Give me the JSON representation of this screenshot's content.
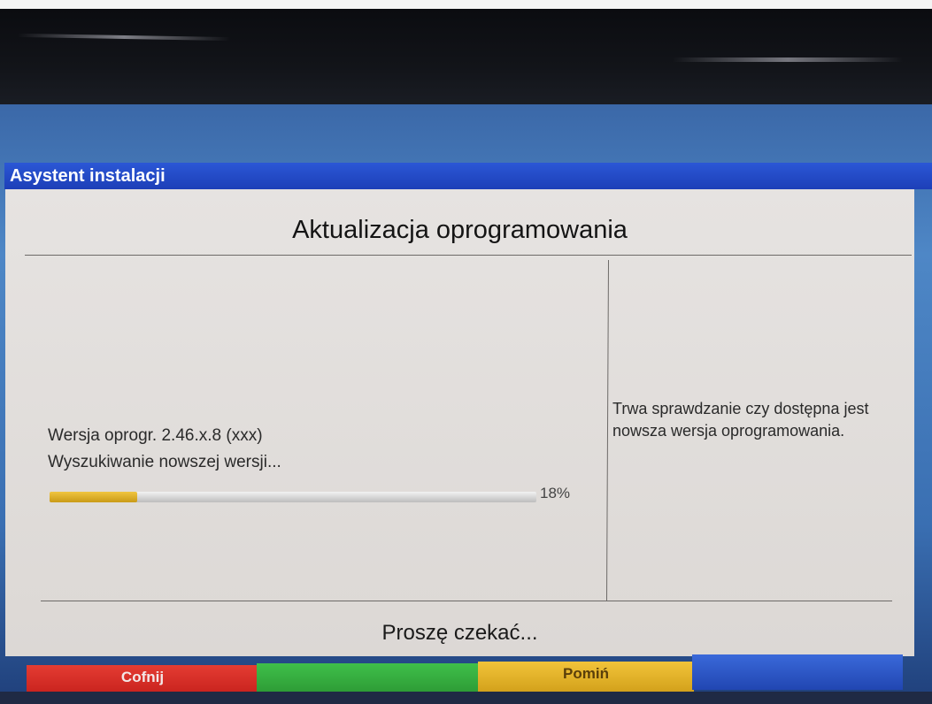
{
  "window": {
    "title": "Asystent instalacji"
  },
  "panel": {
    "heading": "Aktualizacja oprogramowania",
    "version_line": "Wersja oprogr. 2.46.x.8 (xxx)",
    "status_line": "Wyszukiwanie nowszej wersji...",
    "progress_percent": 18,
    "progress_label": "18%",
    "info_text": "Trwa sprawdzanie czy dostępna jest nowsza wersja oprogramowania.",
    "footer_text": "Proszę czekać..."
  },
  "buttons": {
    "red": {
      "label": "Cofnij",
      "color": "#d42b24"
    },
    "green": {
      "label": "",
      "color": "#34ad3f"
    },
    "yellow": {
      "label": "Pomiń",
      "color": "#e4b22a"
    },
    "blue": {
      "label": "",
      "color": "#2b57c8"
    }
  },
  "colors": {
    "title_bar": "#2449c8",
    "panel_bg": "#e2dfdc",
    "progress_fill": "#e0b232"
  }
}
